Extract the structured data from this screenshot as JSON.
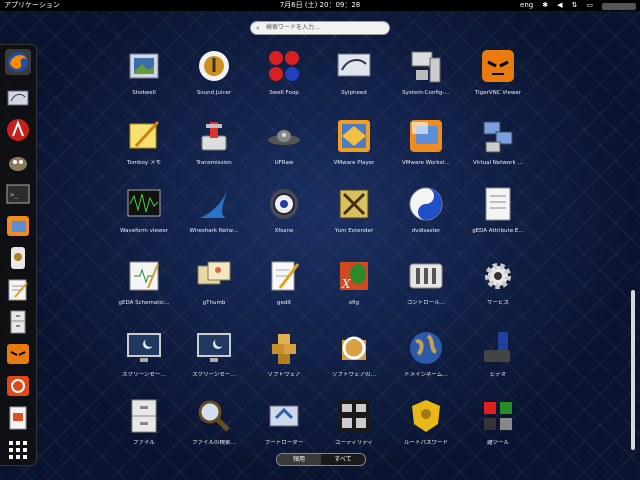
{
  "topbar": {
    "activities_label": "アプリケーション",
    "clock": "7月6日 (土) 20：09：28",
    "keyboard_layout": "eng",
    "tray_icons": [
      "bluetooth-icon",
      "volume-icon",
      "network-icon",
      "battery-icon"
    ]
  },
  "search": {
    "placeholder": "検索ワードを入力…"
  },
  "dash": {
    "favorites": [
      "firefox",
      "sylpheed",
      "adobe-acrobat",
      "gimp",
      "terminal",
      "vmware-workstation",
      "sound-juicer",
      "gedit",
      "file-cabinet",
      "tigervnc",
      "ubuntu-software",
      "document-viewer"
    ],
    "show_apps_icon": "grid-icon"
  },
  "apps": [
    {
      "label": "Shotwell",
      "icon": "shotwell"
    },
    {
      "label": "Sound Juicer",
      "icon": "sound-juicer"
    },
    {
      "label": "Swell Foop",
      "icon": "swell-foop"
    },
    {
      "label": "Sylpheed",
      "icon": "sylpheed"
    },
    {
      "label": "System-Config-…",
      "icon": "system-config"
    },
    {
      "label": "TigerVNC Viewer",
      "icon": "tigervnc"
    },
    {
      "label": "Tomboy メモ",
      "icon": "tomboy"
    },
    {
      "label": "Transmission",
      "icon": "transmission"
    },
    {
      "label": "UFRaw",
      "icon": "ufraw"
    },
    {
      "label": "VMware Player",
      "icon": "vmware-player"
    },
    {
      "label": "VMware Workst…",
      "icon": "vmware-workstation"
    },
    {
      "label": "Virtual Network …",
      "icon": "virtual-network"
    },
    {
      "label": "Waveform viewer",
      "icon": "waveform"
    },
    {
      "label": "Wireshark Netw…",
      "icon": "wireshark"
    },
    {
      "label": "Xfsane",
      "icon": "xsane"
    },
    {
      "label": "Yum Extender",
      "icon": "yum-extender"
    },
    {
      "label": "dvdisaster",
      "icon": "dvdisaster"
    },
    {
      "label": "gEDA Attribute E…",
      "icon": "geda-attribute"
    },
    {
      "label": "gEDA Schematic…",
      "icon": "geda-schematic"
    },
    {
      "label": "gThumb",
      "icon": "gthumb"
    },
    {
      "label": "gedit",
      "icon": "gedit"
    },
    {
      "label": "xfig",
      "icon": "xfig"
    },
    {
      "label": "コントロール…",
      "icon": "control-center"
    },
    {
      "label": "サービス",
      "icon": "services"
    },
    {
      "label": "スクリーンセー…",
      "icon": "screensaver-1"
    },
    {
      "label": "スクリーンセー…",
      "icon": "screensaver-2"
    },
    {
      "label": "ソフトウェア",
      "icon": "software"
    },
    {
      "label": "ソフトウェアの…",
      "icon": "software-update"
    },
    {
      "label": "ドメインネーム…",
      "icon": "domain-name"
    },
    {
      "label": "ビデオ",
      "icon": "video"
    },
    {
      "label": "ファイル",
      "icon": "files"
    },
    {
      "label": "ファイルの検索…",
      "icon": "file-search"
    },
    {
      "label": "ブートローダー",
      "icon": "bootloader"
    },
    {
      "label": "ユーティリティ",
      "icon": "utilities"
    },
    {
      "label": "ルートパスワード",
      "icon": "root-password"
    },
    {
      "label": "雑ツール",
      "icon": "misc-tools"
    }
  ],
  "view_switch": {
    "frequent_label": "頻用",
    "all_label": "すべて"
  },
  "colors": {
    "background": "#0a1430",
    "topbar": "#000000"
  }
}
